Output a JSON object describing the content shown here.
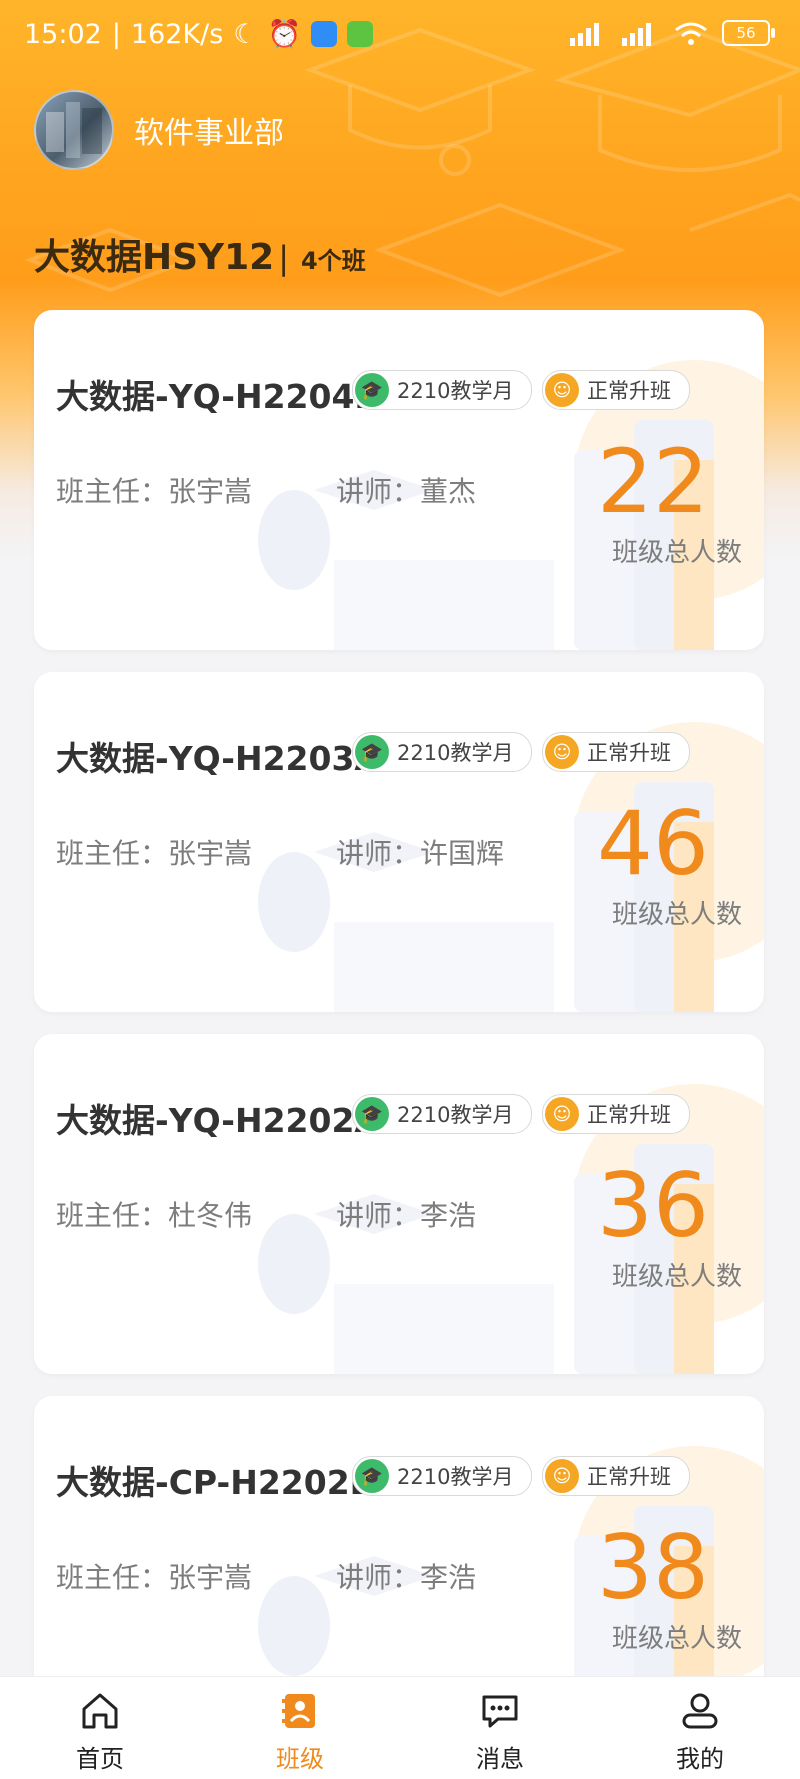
{
  "status_bar": {
    "time": "15:02",
    "speed": "162K/s",
    "battery": "56"
  },
  "header": {
    "department": "软件事业部",
    "group_name": "大数据HSY12",
    "separator": "|",
    "class_count": "4个班"
  },
  "classes": [
    {
      "name": "大数据-YQ-H2204B",
      "term": "2210教学月",
      "status": "正常升班",
      "head_teacher": "班主任：张宇嵩",
      "lecturer": "讲师：董杰",
      "count": "22",
      "count_label": "班级总人数"
    },
    {
      "name": "大数据-YQ-H2203A",
      "term": "2210教学月",
      "status": "正常升班",
      "head_teacher": "班主任：张宇嵩",
      "lecturer": "讲师：许国辉",
      "count": "46",
      "count_label": "班级总人数"
    },
    {
      "name": "大数据-YQ-H2202A",
      "term": "2210教学月",
      "status": "正常升班",
      "head_teacher": "班主任：杜冬伟",
      "lecturer": "讲师：李浩",
      "count": "36",
      "count_label": "班级总人数"
    },
    {
      "name": "大数据-CP-H2202B",
      "term": "2210教学月",
      "status": "正常升班",
      "head_teacher": "班主任：张宇嵩",
      "lecturer": "讲师：李浩",
      "count": "38",
      "count_label": "班级总人数"
    }
  ],
  "tabs": [
    {
      "label": "首页",
      "icon": "home-icon"
    },
    {
      "label": "班级",
      "icon": "class-icon"
    },
    {
      "label": "消息",
      "icon": "message-icon"
    },
    {
      "label": "我的",
      "icon": "profile-icon"
    }
  ],
  "colors": {
    "accent": "#f08a1c",
    "header": "#ffa51f",
    "term_badge": "#3dbb6b",
    "status_badge": "#f5a623"
  }
}
